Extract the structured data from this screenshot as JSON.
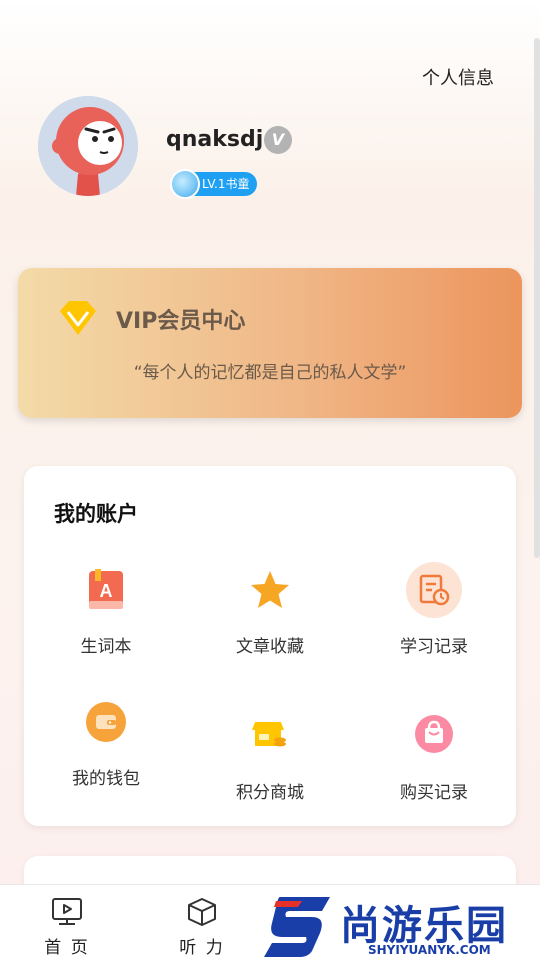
{
  "header": {
    "profile_info_link": "个人信息"
  },
  "user": {
    "username": "qnaksdj",
    "verified_icon": "verified-v-icon",
    "level_badge": "LV.1书童"
  },
  "vip": {
    "title": "VIP会员中心",
    "quote": "“每个人的记忆都是自己的私人文学”"
  },
  "account": {
    "title": "我的账户",
    "items": [
      {
        "label": "生词本",
        "icon": "vocabulary-book-icon"
      },
      {
        "label": "文章收藏",
        "icon": "star-icon"
      },
      {
        "label": "学习记录",
        "icon": "study-record-icon"
      },
      {
        "label": "我的钱包",
        "icon": "wallet-icon"
      },
      {
        "label": "积分商城",
        "icon": "points-store-icon"
      },
      {
        "label": "购买记录",
        "icon": "shopping-bag-icon"
      }
    ]
  },
  "nav": {
    "items": [
      {
        "label": "首 页",
        "icon": "video-home-icon"
      },
      {
        "label": "听 力",
        "icon": "box-listening-icon"
      }
    ]
  },
  "watermark": {
    "text": "尚游乐园",
    "sub": "SHYIYUANYK.COM"
  },
  "colors": {
    "badge_blue": "#1fa0f2",
    "vip_start": "#f3dba8",
    "vip_end": "#ec955d",
    "accent_orange": "#f6a623"
  }
}
